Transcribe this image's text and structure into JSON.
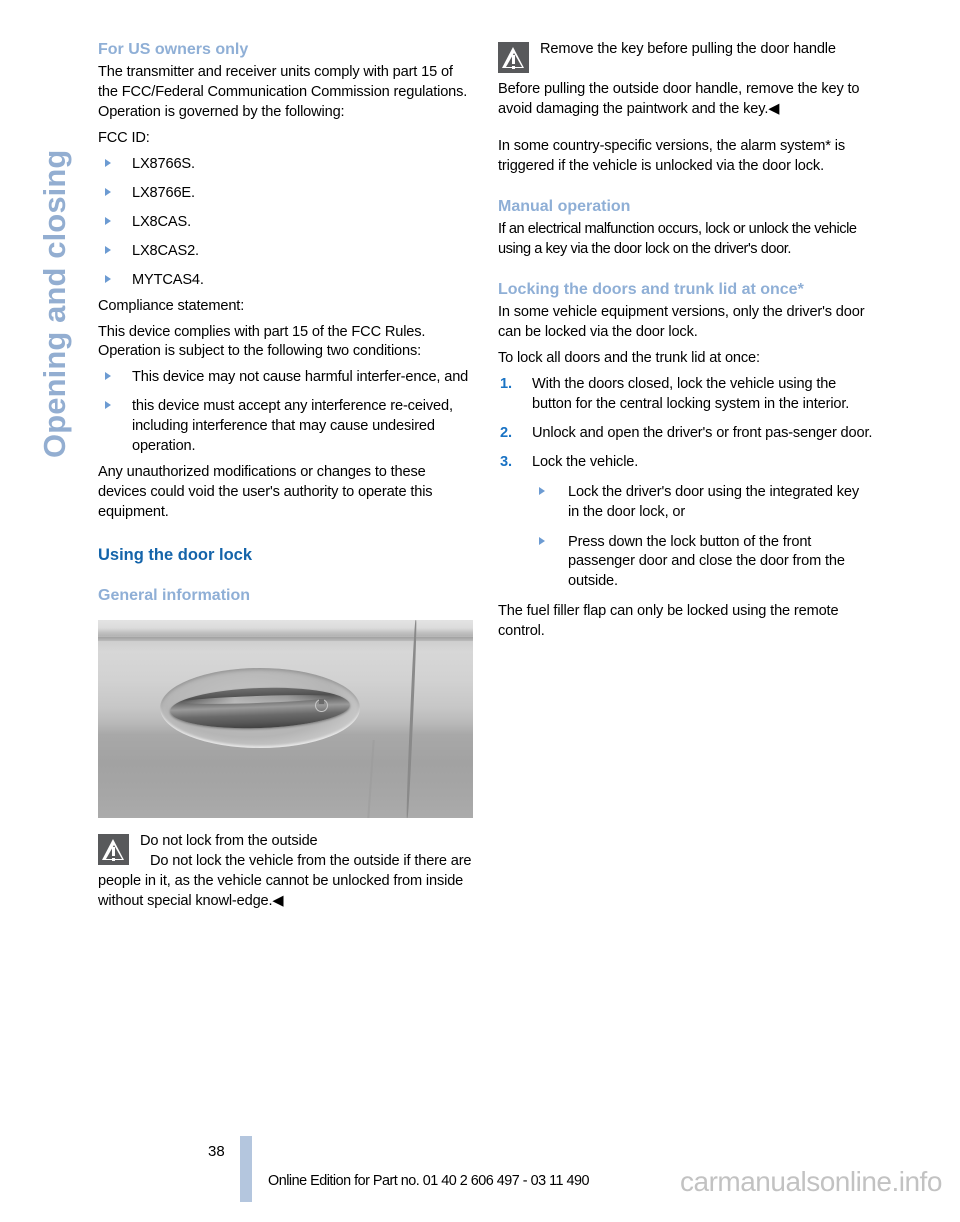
{
  "chapter_tab": {
    "label": "Opening and closing"
  },
  "colors": {
    "heading_major": "#1464aa",
    "heading_minor": "#8fafd6",
    "chapter_tab": "#93aed1",
    "bullet_marker": "#6c9bd2",
    "number_marker": "#1a73c4",
    "warning_icon_bg": "#58595b",
    "footer_bar": "#b4c6de"
  },
  "left_column": {
    "heading_us_owners": "For US owners only",
    "para_transmitter": "The transmitter and receiver units comply with part 15 of the FCC/Federal Communication Commission regulations. Operation is governed by the following:",
    "label_fcc_id": "FCC ID:",
    "fcc_ids": [
      "LX8766S.",
      "LX8766E.",
      "LX8CAS.",
      "LX8CAS2.",
      "MYTCAS4."
    ],
    "label_compliance": "Compliance statement:",
    "para_complies": "This device complies with part 15 of the FCC Rules. Operation is subject to the following two conditions:",
    "conditions": [
      "This device may not cause harmful interfer-ence, and",
      "this device must accept any interference re-ceived, including interference that may cause undesired operation."
    ],
    "para_unauthorized": "Any unauthorized modifications or changes to these devices could void the user's authority to operate this equipment.",
    "heading_using_door_lock": "Using the door lock",
    "heading_general_information": "General information",
    "figure": {
      "alt": "car-door-handle-illustration"
    },
    "warning": {
      "icon": "warning-triangle-icon",
      "title": "Do not lock from the outside",
      "text": "Do not lock the vehicle from the outside if there are people in it, as the vehicle cannot be unlocked from inside without special knowl-edge.",
      "end_marker": "◀"
    }
  },
  "right_column": {
    "warning": {
      "icon": "warning-triangle-icon",
      "title": "Remove the key before pulling the door handle",
      "text": "Before pulling the outside door handle, remove the key to avoid damaging the paintwork and the key.",
      "end_marker": "◀"
    },
    "para_alarm": "In some country-specific versions, the alarm system* is triggered if the vehicle is unlocked via the door lock.",
    "heading_manual_operation": "Manual operation",
    "para_manual": "If an electrical malfunction occurs, lock or unlock the vehicle using a key via the door lock on the driver's door.",
    "heading_locking_once": "Locking the doors and trunk lid at once*",
    "para_equipment_versions": "In some vehicle equipment versions, only the driver's door can be locked via the door lock.",
    "para_to_lock": "To lock all doors and the trunk lid at once:",
    "steps": [
      {
        "number": "1.",
        "text": "With the doors closed, lock the vehicle using the button for the central locking system in the interior."
      },
      {
        "number": "2.",
        "text": "Unlock and open the driver's or front pas-senger door."
      },
      {
        "number": "3.",
        "text": "Lock the vehicle."
      }
    ],
    "step3_substeps": [
      "Lock the driver's door using the integrated key in the door lock, or",
      "Press down the lock button of the front passenger door and close the door from the outside."
    ],
    "para_fuel_flap": "The fuel filler flap can only be locked using the remote control."
  },
  "footer": {
    "page_number": "38",
    "edition_text": "Online Edition for Part no. 01 40 2 606 497 - 03 11 490",
    "watermark": "carmanualsonline.info"
  }
}
